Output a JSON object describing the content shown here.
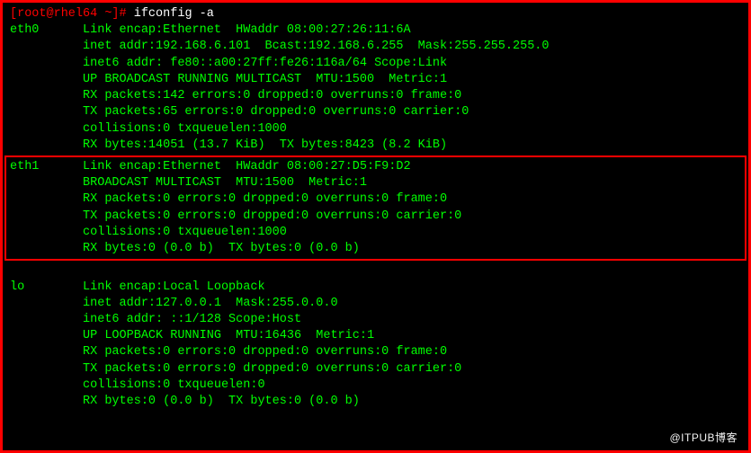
{
  "prompt": {
    "user_host": "[root@rhel64 ~]# ",
    "command": "ifconfig -a"
  },
  "eth0": {
    "name": "eth0",
    "l1": "Link encap:Ethernet  HWaddr 08:00:27:26:11:6A",
    "l2": "inet addr:192.168.6.101  Bcast:192.168.6.255  Mask:255.255.255.0",
    "l3": "inet6 addr: fe80::a00:27ff:fe26:116a/64 Scope:Link",
    "l4": "UP BROADCAST RUNNING MULTICAST  MTU:1500  Metric:1",
    "l5": "RX packets:142 errors:0 dropped:0 overruns:0 frame:0",
    "l6": "TX packets:65 errors:0 dropped:0 overruns:0 carrier:0",
    "l7": "collisions:0 txqueuelen:1000",
    "l8": "RX bytes:14051 (13.7 KiB)  TX bytes:8423 (8.2 KiB)"
  },
  "eth1": {
    "name": "eth1",
    "l1": "Link encap:Ethernet  HWaddr 08:00:27:D5:F9:D2",
    "l2": "BROADCAST MULTICAST  MTU:1500  Metric:1",
    "l3": "RX packets:0 errors:0 dropped:0 overruns:0 frame:0",
    "l4": "TX packets:0 errors:0 dropped:0 overruns:0 carrier:0",
    "l5": "collisions:0 txqueuelen:1000",
    "l6": "RX bytes:0 (0.0 b)  TX bytes:0 (0.0 b)"
  },
  "lo": {
    "name": "lo",
    "l1": "Link encap:Local Loopback",
    "l2": "inet addr:127.0.0.1  Mask:255.0.0.0",
    "l3": "inet6 addr: ::1/128 Scope:Host",
    "l4": "UP LOOPBACK RUNNING  MTU:16436  Metric:1",
    "l5": "RX packets:0 errors:0 dropped:0 overruns:0 frame:0",
    "l6": "TX packets:0 errors:0 dropped:0 overruns:0 carrier:0",
    "l7": "collisions:0 txqueuelen:0",
    "l8": "RX bytes:0 (0.0 b)  TX bytes:0 (0.0 b)"
  },
  "watermark": "@ITPUB博客",
  "pad": {
    "col1": "          ",
    "name_eth0": "eth0      ",
    "name_eth1": "eth1      ",
    "name_lo": "lo        "
  }
}
